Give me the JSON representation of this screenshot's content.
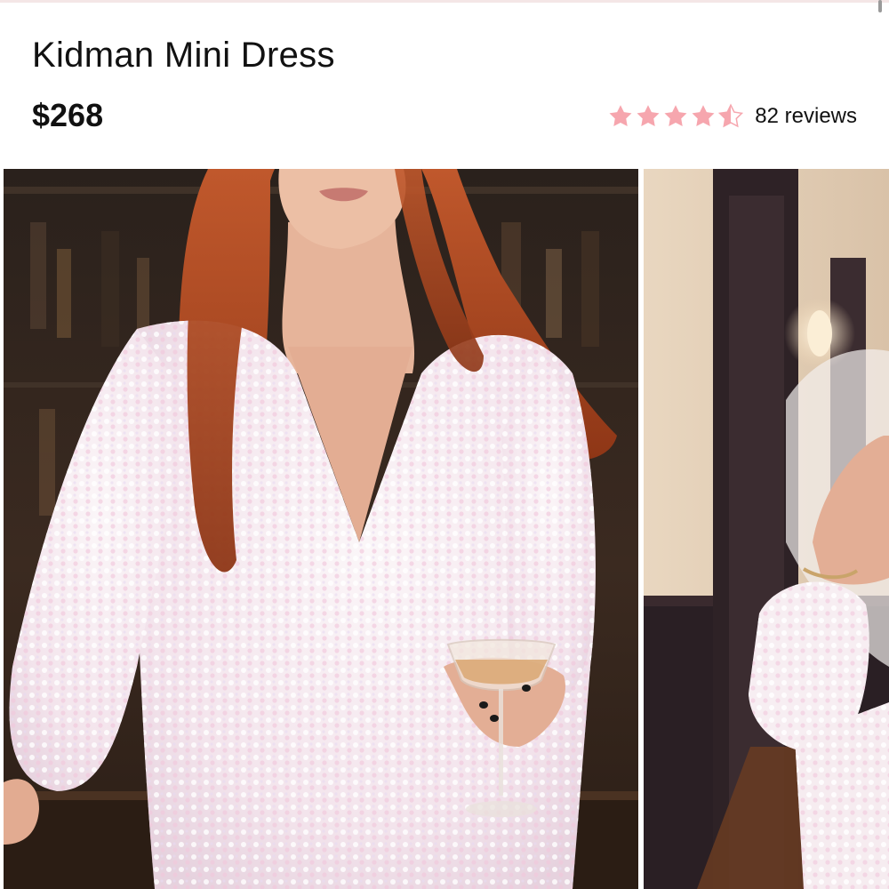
{
  "product": {
    "title": "Kidman Mini Dress",
    "price": "$268"
  },
  "rating": {
    "value": 4.5,
    "max": 5,
    "reviews_label": "82 reviews",
    "star_icon": "star-icon",
    "star_color": "#f6a6ae",
    "star_empty_color": "#f7d9dc"
  },
  "gallery": {
    "images": [
      {
        "name": "product-photo-main"
      },
      {
        "name": "product-photo-secondary"
      }
    ]
  },
  "colors": {
    "text": "#111111",
    "dress": "#f7eef2",
    "hair": "#b04a20"
  }
}
